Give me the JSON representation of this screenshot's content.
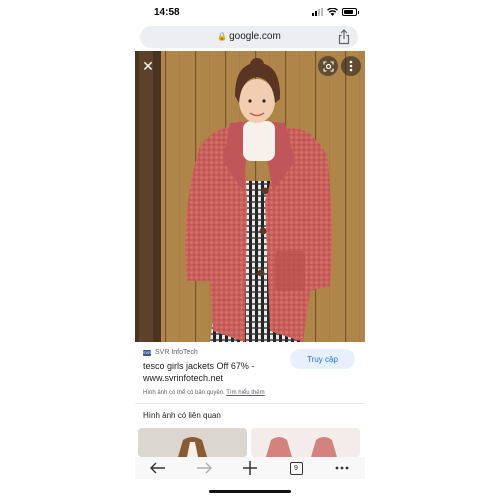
{
  "status": {
    "time": "14:58",
    "battery_level": 0.8
  },
  "browser": {
    "url": "google.com"
  },
  "result": {
    "source": "SVR InfoTech",
    "source_logo_text": "SVR",
    "title": "tesco girls jackets Off 67% - www.svrinfotech.net",
    "visit_label": "Truy cập",
    "copyright_text": "Hình ảnh có thể có bản quyền.",
    "learn_more": "Tìm hiểu thêm"
  },
  "related": {
    "heading": "Hình ảnh có liên quan"
  },
  "toolbar": {
    "tab_count": "9"
  },
  "icons": {
    "close": "close-icon",
    "lens": "lens-icon",
    "more": "more-vert-icon",
    "back": "back-arrow-icon",
    "forward": "forward-arrow-icon",
    "new_tab": "plus-icon",
    "tabs": "tabs-icon",
    "menu": "more-horiz-icon"
  }
}
